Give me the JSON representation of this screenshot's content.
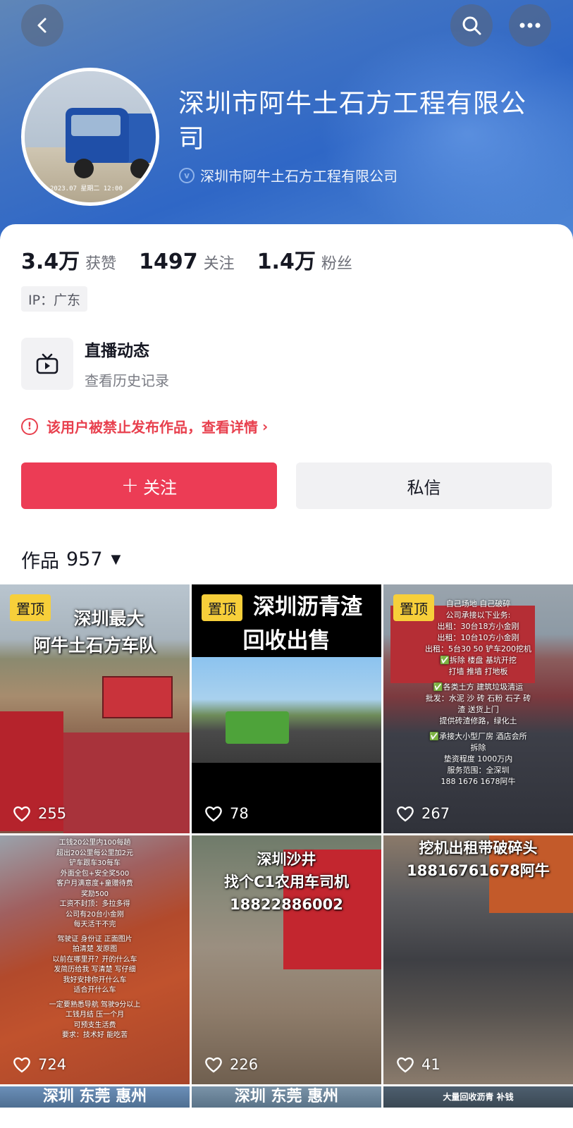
{
  "header": {
    "company_name": "深圳市阿牛土石方工程有限公司",
    "verified_name": "深圳市阿牛土石方工程有限公司",
    "avatar_stamp": "2023.07 星期二 12:00"
  },
  "stats": {
    "likes_value": "3.4万",
    "likes_label": "获赞",
    "following_value": "1497",
    "following_label": "关注",
    "followers_value": "1.4万",
    "followers_label": "粉丝"
  },
  "ip_tag": "IP：广东",
  "live": {
    "title": "直播动态",
    "subtitle": "查看历史记录"
  },
  "ban_notice": "该用户被禁止发布作品，查看详情",
  "actions": {
    "follow_plus": "+",
    "follow_label": "关注",
    "message_label": "私信"
  },
  "works": {
    "label": "作品",
    "count": "957"
  },
  "videos": [
    {
      "pinned": "置顶",
      "likes": "255",
      "caption1": "深圳最大",
      "caption2": "阿牛土石方车队"
    },
    {
      "pinned": "置顶",
      "likes": "78",
      "caption1": "深圳沥青渣",
      "caption2": "回收出售"
    },
    {
      "pinned": "置顶",
      "likes": "267",
      "lines": [
        "自己场地 自己破碎",
        "公司承接以下业务:",
        "出租：30台18方小金刚",
        "出租：10台10方小金刚",
        "出租：5台30 50 铲车200挖机",
        "✅拆除 楼盘 基坑开挖",
        "打墙 推墙 打地板",
        "✅各类土方 建筑垃圾清运",
        "批发：水泥 沙 砖 石粉 石子 砖",
        "渣 送货上门",
        "提供砖渣修路，绿化土",
        "✅承接大小型厂房 酒店会所",
        "拆除",
        "垫资程度 1000万内",
        "服务范围：全深圳",
        "188 1676 1678阿牛"
      ]
    },
    {
      "likes": "724",
      "lines": [
        "工钱20公里内100每趟",
        "超出20公里每公里加2元",
        "铲车跟车30每车",
        "外面全包+安全奖500",
        "客户月满意度+童赠待费",
        "奖励500",
        "工资不封顶：多拉多得",
        "公司有20台小金刚",
        "每天活干不完",
        "驾驶证 身份证 正面图片",
        "拍清楚 发原图",
        "以前在哪里开？开的什么车",
        "发简历给我 写清楚 写仔细",
        "我好安排你开什么车",
        "适合开什么车",
        "一定要熟悉导航 驾驶9分以上",
        "工钱月结 压一个月",
        "可预支生活费",
        "要求：技术好 能吃苦"
      ]
    },
    {
      "likes": "226",
      "caption1": "深圳沙井",
      "caption2": "找个C1农用车司机",
      "caption3": "18822886002"
    },
    {
      "likes": "41",
      "caption1": "挖机出租带破碎头",
      "caption2": "18816761678阿牛"
    }
  ],
  "peek": [
    "深圳 东莞 惠州",
    "深圳 东莞 惠州",
    "大量回收沥青 补钱"
  ]
}
